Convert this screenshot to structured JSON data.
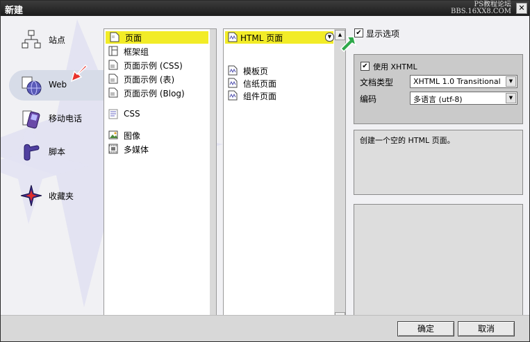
{
  "window": {
    "title": "新建",
    "watermark_line1": "PS教程论坛",
    "watermark_line2": "BBS.16XX8.COM",
    "close_glyph": "✕"
  },
  "categories": [
    {
      "label": "站点",
      "icon": "site-map-icon"
    },
    {
      "label": "Web",
      "icon": "web-globe-icon",
      "selected": true
    },
    {
      "label": "移动电话",
      "icon": "mobile-phone-icon"
    },
    {
      "label": "脚本",
      "icon": "script-scroll-icon"
    },
    {
      "label": "收藏夹",
      "icon": "favorites-star-icon"
    }
  ],
  "types": [
    {
      "label": "页面",
      "icon": "page-icon",
      "selected": true
    },
    {
      "label": "框架组",
      "icon": "frameset-icon"
    },
    {
      "label": "页面示例 (CSS)",
      "icon": "sample-page-icon"
    },
    {
      "label": "页面示例 (表)",
      "icon": "sample-page-icon"
    },
    {
      "label": "页面示例 (Blog)",
      "icon": "sample-page-icon"
    },
    {
      "label": "CSS",
      "icon": "css-icon"
    },
    {
      "label": "图像",
      "icon": "image-icon"
    },
    {
      "label": "多媒体",
      "icon": "multimedia-icon"
    }
  ],
  "templates": [
    {
      "label": "HTML 页面",
      "icon": "html-page-icon",
      "selected": true
    },
    {
      "label": "模板页",
      "icon": "template-page-icon"
    },
    {
      "label": "信纸页面",
      "icon": "stationery-page-icon"
    },
    {
      "label": "组件页面",
      "icon": "component-page-icon"
    }
  ],
  "options": {
    "show_options_label": "显示选项",
    "show_options_checked": true,
    "use_xhtml_label": "使用 XHTML",
    "use_xhtml_checked": true,
    "doctype_label": "文档类型",
    "doctype_value": "XHTML 1.0 Transitional",
    "encoding_label": "编码",
    "encoding_value": "多语言 (utf-8)"
  },
  "description": "创建一个空的 HTML 页面。",
  "buttons": {
    "ok": "确定",
    "cancel": "取消"
  },
  "colors": {
    "selection": "#f2ec27",
    "annotation_red": "#e8322b",
    "annotation_green": "#2ea84a"
  }
}
